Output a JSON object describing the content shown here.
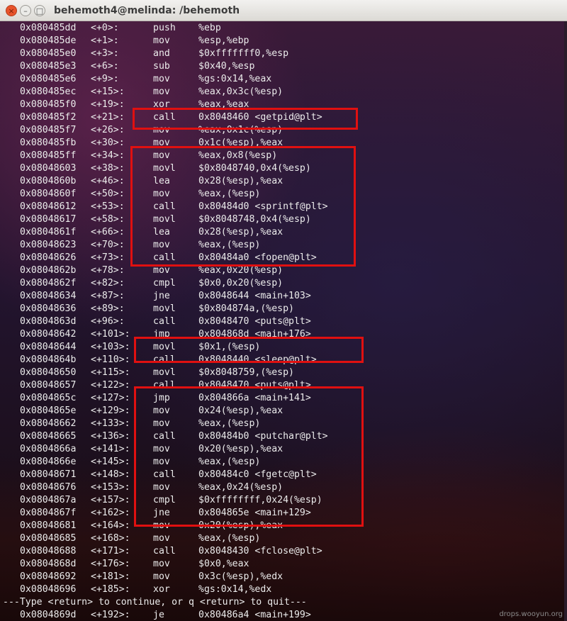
{
  "window": {
    "title": "behemoth4@melinda: /behemoth",
    "close_glyph": "×",
    "min_glyph": "–",
    "max_glyph": "□"
  },
  "terminal": {
    "lines": [
      {
        "addr": "0x080485dd",
        "off": "<+0>:",
        "mn": "push",
        "ops": "%ebp"
      },
      {
        "addr": "0x080485de",
        "off": "<+1>:",
        "mn": "mov",
        "ops": "%esp,%ebp"
      },
      {
        "addr": "0x080485e0",
        "off": "<+3>:",
        "mn": "and",
        "ops": "$0xfffffff0,%esp"
      },
      {
        "addr": "0x080485e3",
        "off": "<+6>:",
        "mn": "sub",
        "ops": "$0x40,%esp"
      },
      {
        "addr": "0x080485e6",
        "off": "<+9>:",
        "mn": "mov",
        "ops": "%gs:0x14,%eax"
      },
      {
        "addr": "0x080485ec",
        "off": "<+15>:",
        "mn": "mov",
        "ops": "%eax,0x3c(%esp)"
      },
      {
        "addr": "0x080485f0",
        "off": "<+19>:",
        "mn": "xor",
        "ops": "%eax,%eax"
      },
      {
        "addr": "0x080485f2",
        "off": "<+21>:",
        "mn": "call",
        "ops": "0x8048460 <getpid@plt>"
      },
      {
        "addr": "0x080485f7",
        "off": "<+26>:",
        "mn": "mov",
        "ops": "%eax,0x1c(%esp)"
      },
      {
        "addr": "0x080485fb",
        "off": "<+30>:",
        "mn": "mov",
        "ops": "0x1c(%esp),%eax"
      },
      {
        "addr": "0x080485ff",
        "off": "<+34>:",
        "mn": "mov",
        "ops": "%eax,0x8(%esp)"
      },
      {
        "addr": "0x08048603",
        "off": "<+38>:",
        "mn": "movl",
        "ops": "$0x8048740,0x4(%esp)"
      },
      {
        "addr": "0x0804860b",
        "off": "<+46>:",
        "mn": "lea",
        "ops": "0x28(%esp),%eax"
      },
      {
        "addr": "0x0804860f",
        "off": "<+50>:",
        "mn": "mov",
        "ops": "%eax,(%esp)"
      },
      {
        "addr": "0x08048612",
        "off": "<+53>:",
        "mn": "call",
        "ops": "0x80484d0 <sprintf@plt>"
      },
      {
        "addr": "0x08048617",
        "off": "<+58>:",
        "mn": "movl",
        "ops": "$0x8048748,0x4(%esp)"
      },
      {
        "addr": "0x0804861f",
        "off": "<+66>:",
        "mn": "lea",
        "ops": "0x28(%esp),%eax"
      },
      {
        "addr": "0x08048623",
        "off": "<+70>:",
        "mn": "mov",
        "ops": "%eax,(%esp)"
      },
      {
        "addr": "0x08048626",
        "off": "<+73>:",
        "mn": "call",
        "ops": "0x80484a0 <fopen@plt>"
      },
      {
        "addr": "0x0804862b",
        "off": "<+78>:",
        "mn": "mov",
        "ops": "%eax,0x20(%esp)"
      },
      {
        "addr": "0x0804862f",
        "off": "<+82>:",
        "mn": "cmpl",
        "ops": "$0x0,0x20(%esp)"
      },
      {
        "addr": "0x08048634",
        "off": "<+87>:",
        "mn": "jne",
        "ops": "0x8048644 <main+103>"
      },
      {
        "addr": "0x08048636",
        "off": "<+89>:",
        "mn": "movl",
        "ops": "$0x804874a,(%esp)"
      },
      {
        "addr": "0x0804863d",
        "off": "<+96>:",
        "mn": "call",
        "ops": "0x8048470 <puts@plt>"
      },
      {
        "addr": "0x08048642",
        "off": "<+101>:",
        "mn": "jmp",
        "ops": "0x804868d <main+176>"
      },
      {
        "addr": "0x08048644",
        "off": "<+103>:",
        "mn": "movl",
        "ops": "$0x1,(%esp)"
      },
      {
        "addr": "0x0804864b",
        "off": "<+110>:",
        "mn": "call",
        "ops": "0x8048440 <sleep@plt>"
      },
      {
        "addr": "0x08048650",
        "off": "<+115>:",
        "mn": "movl",
        "ops": "$0x8048759,(%esp)"
      },
      {
        "addr": "0x08048657",
        "off": "<+122>:",
        "mn": "call",
        "ops": "0x8048470 <puts@plt>"
      },
      {
        "addr": "0x0804865c",
        "off": "<+127>:",
        "mn": "jmp",
        "ops": "0x804866a <main+141>"
      },
      {
        "addr": "0x0804865e",
        "off": "<+129>:",
        "mn": "mov",
        "ops": "0x24(%esp),%eax"
      },
      {
        "addr": "0x08048662",
        "off": "<+133>:",
        "mn": "mov",
        "ops": "%eax,(%esp)"
      },
      {
        "addr": "0x08048665",
        "off": "<+136>:",
        "mn": "call",
        "ops": "0x80484b0 <putchar@plt>"
      },
      {
        "addr": "0x0804866a",
        "off": "<+141>:",
        "mn": "mov",
        "ops": "0x20(%esp),%eax"
      },
      {
        "addr": "0x0804866e",
        "off": "<+145>:",
        "mn": "mov",
        "ops": "%eax,(%esp)"
      },
      {
        "addr": "0x08048671",
        "off": "<+148>:",
        "mn": "call",
        "ops": "0x80484c0 <fgetc@plt>"
      },
      {
        "addr": "0x08048676",
        "off": "<+153>:",
        "mn": "mov",
        "ops": "%eax,0x24(%esp)"
      },
      {
        "addr": "0x0804867a",
        "off": "<+157>:",
        "mn": "cmpl",
        "ops": "$0xffffffff,0x24(%esp)"
      },
      {
        "addr": "0x0804867f",
        "off": "<+162>:",
        "mn": "jne",
        "ops": "0x804865e <main+129>"
      },
      {
        "addr": "0x08048681",
        "off": "<+164>:",
        "mn": "mov",
        "ops": "0x20(%esp),%eax"
      },
      {
        "addr": "0x08048685",
        "off": "<+168>:",
        "mn": "mov",
        "ops": "%eax,(%esp)"
      },
      {
        "addr": "0x08048688",
        "off": "<+171>:",
        "mn": "call",
        "ops": "0x8048430 <fclose@plt>"
      },
      {
        "addr": "0x0804868d",
        "off": "<+176>:",
        "mn": "mov",
        "ops": "$0x0,%eax"
      },
      {
        "addr": "0x08048692",
        "off": "<+181>:",
        "mn": "mov",
        "ops": "0x3c(%esp),%edx"
      },
      {
        "addr": "0x08048696",
        "off": "<+185>:",
        "mn": "xor",
        "ops": "%gs:0x14,%edx"
      },
      {
        "raw": "---Type <return> to continue, or q <return> to quit---"
      },
      {
        "addr": "0x0804869d",
        "off": "<+192>:",
        "mn": "je",
        "ops": "0x80486a4 <main+199>"
      }
    ]
  },
  "highlight_color": "#e01010",
  "watermark": "drops.wooyun.org"
}
